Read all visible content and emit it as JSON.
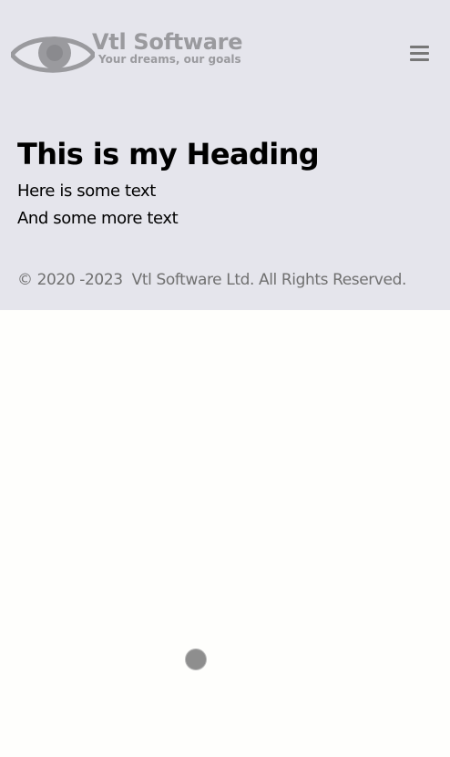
{
  "header": {
    "brand_name": "Vtl Software",
    "brand_tagline": "Your dreams, our goals",
    "logo_icon": "eye-icon",
    "menu_icon": "hamburger-menu-icon"
  },
  "main": {
    "heading": "This is my Heading",
    "paragraphs": [
      "Here is some text",
      "And some more text"
    ]
  },
  "footer": {
    "copyright": "© 2020 -2023  Vtl Software Ltd. All Rights Reserved."
  },
  "loading_indicator": {
    "icon": "loading-dot-icon"
  },
  "colors": {
    "header_background": "#e5e5ec",
    "page_background": "#fefefc",
    "brand_gray": "#9a9a9e",
    "footer_text": "#707070"
  }
}
